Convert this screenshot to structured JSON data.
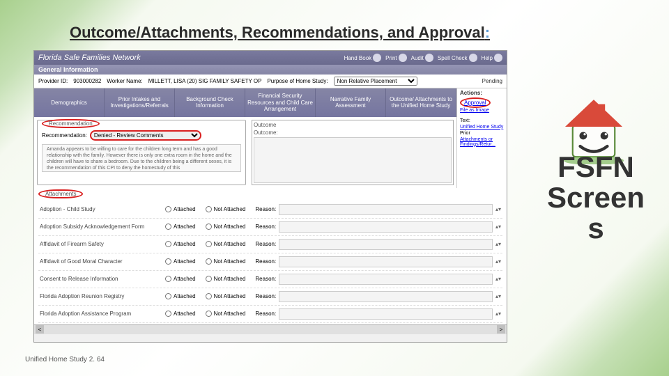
{
  "slide": {
    "title_main": "Outcome/Attachments, Recommendations, and Approval",
    "title_colon": ":"
  },
  "fsfn": {
    "brand": "Florida Safe Families Network",
    "tools": {
      "handbook": "Hand Book",
      "print": "Print",
      "audit": "Audit",
      "spell": "Spell Check",
      "help": "Help"
    },
    "general_info_label": "General Information",
    "info_bar": {
      "provider_id_label": "Provider ID:",
      "provider_id": "903000282",
      "worker_label": "Worker Name:",
      "worker_name": "MILLETT, LISA (20) SIG FAMILY SAFETY OP",
      "purpose_label": "Purpose of Home Study:",
      "purpose_value": "Non Relative Placement",
      "status": "Pending"
    },
    "tabs": [
      "Demographics",
      "Prior Intakes and Investigations/Referrals",
      "Background Check Information",
      "Financial Security Resources and Child Care Arrangement",
      "Narrative Family Assessment",
      "Outcome/ Attachments to the Unified Home Study"
    ],
    "actions": {
      "header": "Actions:",
      "approval": "Approval",
      "file_image": "File as Image"
    },
    "recommendation": {
      "legend": "Recommendation",
      "label": "Recommendation:",
      "select_value": "Denied - Review Comments",
      "narrative": "Amanda appears to be willing to care for the children long term and has a good relationship with the family. However there is only one extra room in the home and the children will have to share a bedroom. Due to the children being a different sexes, it is the recommendation of this CPI to deny the homestudy of this"
    },
    "outcome": {
      "label": "Outcome",
      "sub": "Outcome:"
    },
    "side": {
      "text_label": "Text:",
      "link1": "Unified Home Study",
      "prior": "Prior",
      "link2": "Attachments or Findings/Retur..."
    },
    "attachments": {
      "legend": "Attachments",
      "attached_label": "Attached",
      "not_attached_label": "Not Attached",
      "reason_label": "Reason:",
      "rows": [
        "Adoption - Child Study",
        "Adoption Subsidy Acknowledgement Form",
        "Affidavit of Firearm Safety",
        "Affidavit of Good Moral Character",
        "Consent to Release Information",
        "Florida Adoption Reunion Registry",
        "Florida Adoption Assistance Program"
      ]
    }
  },
  "label_text": "FSFN Screens",
  "footer": "Unified Home Study 2. 64"
}
